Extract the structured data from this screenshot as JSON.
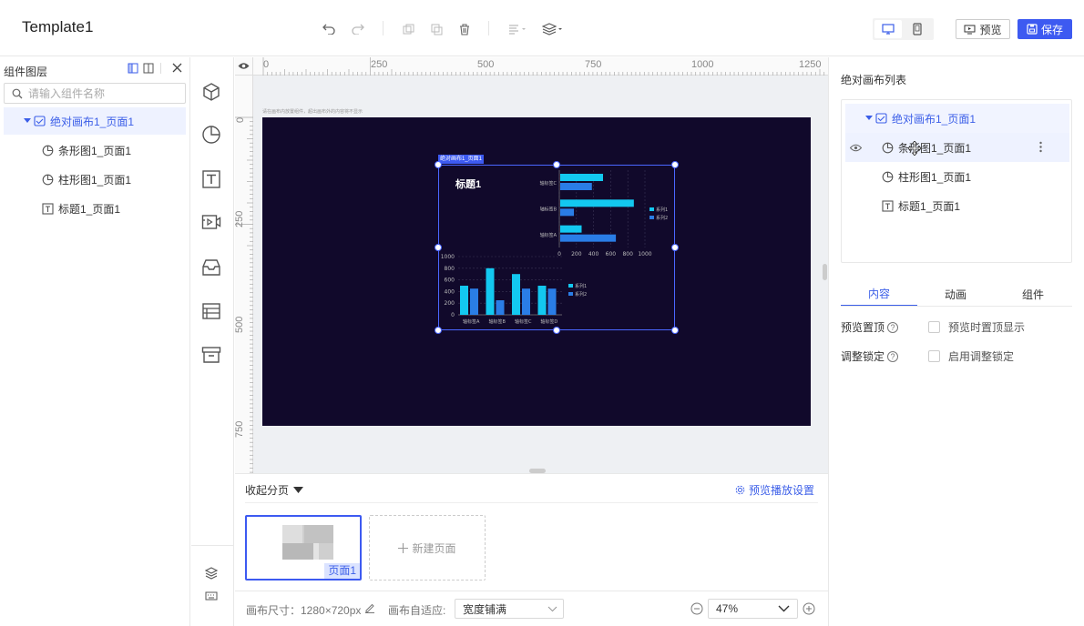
{
  "app": {
    "title": "Template1"
  },
  "toolbar": {
    "preview_label": "预览",
    "save_label": "保存",
    "colors": {
      "accent": "#3d5af1"
    }
  },
  "layers_panel": {
    "title": "组件图层",
    "search_placeholder": "请输入组件名称",
    "items": [
      {
        "label": "绝对画布1_页面1",
        "icon": "canvas-icon",
        "selected": true
      },
      {
        "label": "条形图1_页面1",
        "icon": "pie-chart-icon"
      },
      {
        "label": "柱形图1_页面1",
        "icon": "pie-chart-icon"
      },
      {
        "label": "标题1_页面1",
        "icon": "text-icon"
      }
    ]
  },
  "rulers": {
    "top_labels": [
      "0",
      "250",
      "500",
      "750",
      "1000",
      "1250"
    ],
    "left_labels": [
      "0",
      "250",
      "500",
      "750"
    ]
  },
  "canvas": {
    "hint": "请在画布内放置组件，超出画布外的内容将不显示",
    "background": "#11092b",
    "selection_tag": "绝对画布1_页面1"
  },
  "chart_data": [
    {
      "type": "bar",
      "orientation": "horizontal",
      "categories": [
        "轴标签A",
        "轴标签B",
        "轴标签C"
      ],
      "series": [
        {
          "name": "系列1",
          "values": [
            250,
            860,
            500
          ]
        },
        {
          "name": "系列2",
          "values": [
            650,
            160,
            370
          ]
        }
      ],
      "xlim": [
        0,
        1000
      ],
      "xticks": [
        "0",
        "200",
        "400",
        "600",
        "800",
        "1000"
      ],
      "legend": "right",
      "colors": [
        "#13c8f0",
        "#2a7de6"
      ]
    },
    {
      "type": "bar",
      "orientation": "vertical",
      "title": "标题1",
      "categories": [
        "轴标签A",
        "轴标签B",
        "轴标签C",
        "轴标签D"
      ],
      "series": [
        {
          "name": "系列1",
          "values": [
            500,
            800,
            700,
            500
          ]
        },
        {
          "name": "系列2",
          "values": [
            450,
            250,
            450,
            450
          ]
        }
      ],
      "ylim": [
        0,
        1000
      ],
      "yticks": [
        "0",
        "200",
        "400",
        "600",
        "800",
        "1000"
      ],
      "legend": "right",
      "colors": [
        "#13c8f0",
        "#2a7de6"
      ]
    }
  ],
  "pages": {
    "collapse_label": "收起分页",
    "settings_label": "预览播放设置",
    "page_label": "页面1",
    "new_page_label": "新建页面"
  },
  "bottom": {
    "canvas_size_label": "画布尺寸：1280×720px",
    "fit_label": "画布自适应:",
    "fit_value": "宽度铺满",
    "zoom_value": "47%"
  },
  "right_panel": {
    "title": "绝对画布列表",
    "items": [
      {
        "label": "绝对画布1_页面1",
        "icon": "canvas-icon",
        "root": true
      },
      {
        "label": "条形图1_页面1",
        "icon": "pie-chart-icon",
        "hovered": true
      },
      {
        "label": "柱形图1_页面1",
        "icon": "pie-chart-icon"
      },
      {
        "label": "标题1_页面1",
        "icon": "text-icon"
      }
    ],
    "tabs": [
      "内容",
      "动画",
      "组件"
    ],
    "active_tab": "内容",
    "settings": [
      {
        "label": "预览置顶",
        "option": "预览时置顶显示",
        "checked": false
      },
      {
        "label": "调整锁定",
        "option": "启用调整锁定",
        "checked": false
      }
    ]
  }
}
